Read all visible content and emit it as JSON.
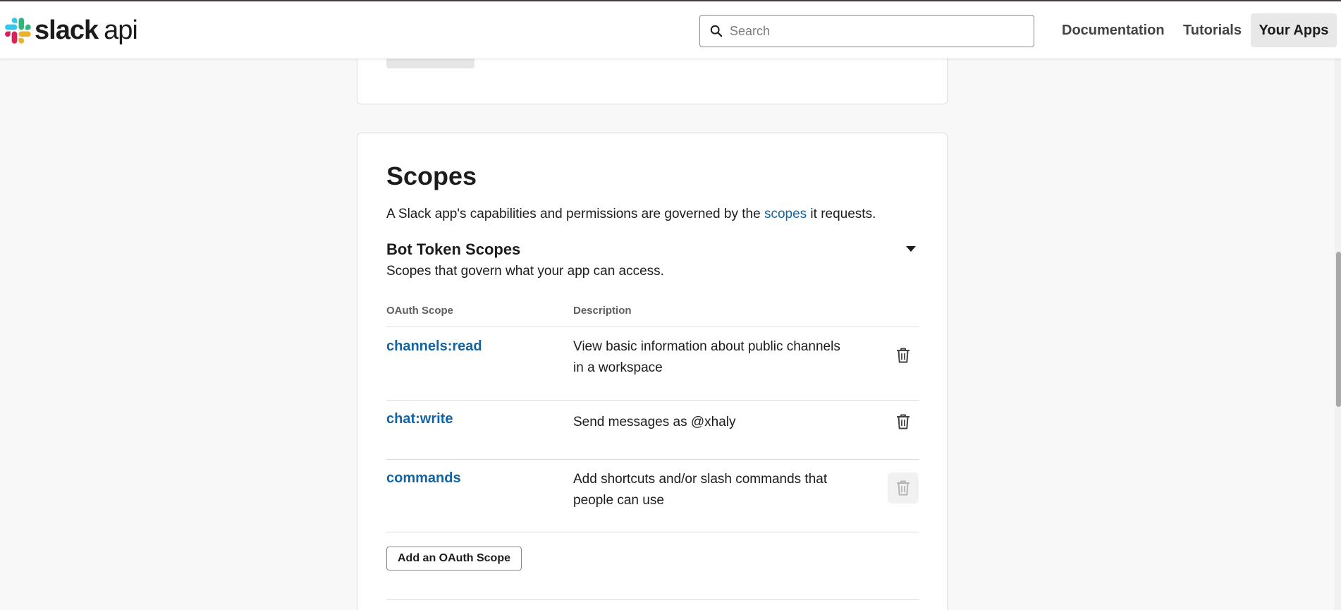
{
  "header": {
    "logo_slack": "slack",
    "logo_api": "api",
    "search_placeholder": "Search",
    "nav": {
      "documentation": "Documentation",
      "tutorials": "Tutorials",
      "your_apps": "Your Apps"
    }
  },
  "scopes": {
    "title": "Scopes",
    "intro_before": "A Slack app's capabilities and permissions are governed by the ",
    "intro_link": "scopes",
    "intro_after": " it requests.",
    "bot_section_title": "Bot Token Scopes",
    "bot_section_desc": "Scopes that govern what your app can access.",
    "columns": {
      "scope": "OAuth Scope",
      "description": "Description"
    },
    "rows": [
      {
        "scope": "channels:read",
        "description": "View basic information about public channels in a workspace"
      },
      {
        "scope": "chat:write",
        "description": "Send messages as @xhaly"
      },
      {
        "scope": "commands",
        "description": "Add shortcuts and/or slash commands that people can use"
      }
    ],
    "add_button": "Add an OAuth Scope"
  },
  "icons": {
    "logo": "slack-logo-icon",
    "search": "search-icon",
    "caret": "caret-down-icon",
    "delete": "trash-icon"
  },
  "colors": {
    "link": "#1264a3",
    "text": "#1d1c1d",
    "background": "#f8f8f8"
  }
}
